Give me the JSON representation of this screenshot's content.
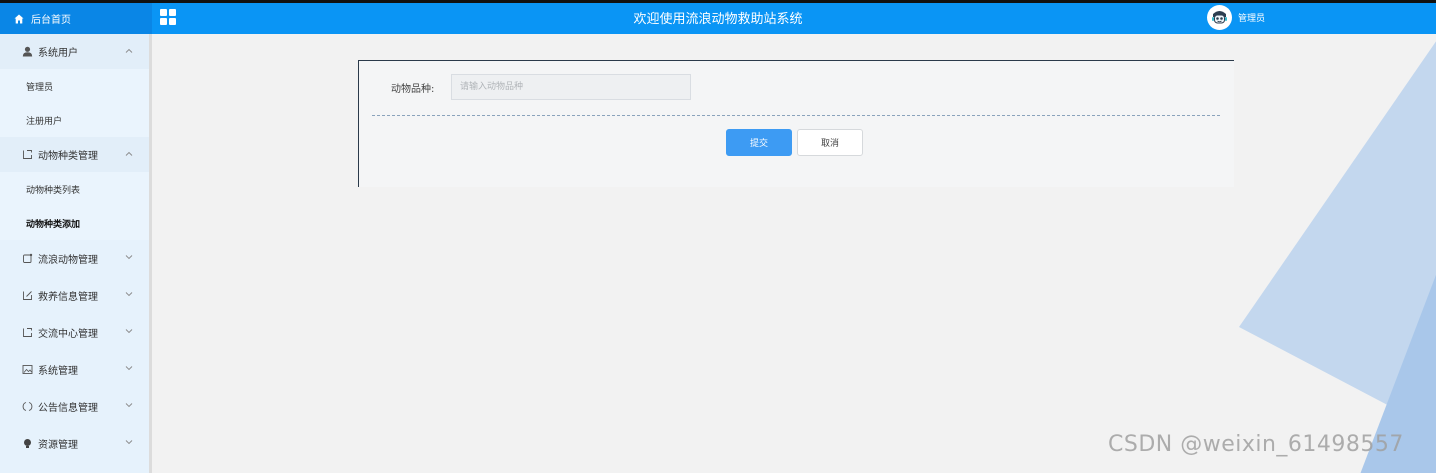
{
  "header": {
    "home_label": "后台首页",
    "title": "欢迎使用流浪动物救助站系统",
    "user_name": "管理员"
  },
  "sidebar": {
    "groups": [
      {
        "label": "系统用户",
        "icon": "user-icon",
        "expanded": true,
        "items": [
          "管理员",
          "注册用户"
        ]
      },
      {
        "label": "动物种类管理",
        "icon": "tag-icon",
        "expanded": true,
        "items": [
          "动物种类列表",
          "动物种类添加"
        ]
      },
      {
        "label": "流浪动物管理",
        "icon": "edit-icon",
        "expanded": false
      },
      {
        "label": "救养信息管理",
        "icon": "edit-icon",
        "expanded": false
      },
      {
        "label": "交流中心管理",
        "icon": "tag-icon",
        "expanded": false
      },
      {
        "label": "系统管理",
        "icon": "picture-icon",
        "expanded": false
      },
      {
        "label": "公告信息管理",
        "icon": "circle-icon",
        "expanded": false
      },
      {
        "label": "资源管理",
        "icon": "bulb-icon",
        "expanded": false
      }
    ],
    "active_item": "动物种类添加"
  },
  "form": {
    "field_label": "动物品种:",
    "field_value": "",
    "field_placeholder": "请输入动物品种",
    "submit_label": "提交",
    "cancel_label": "取消"
  },
  "watermark": "CSDN @weixin_61498557",
  "colors": {
    "header_bg": "#0a95f5",
    "sidebar_bg": "#e6f2fc",
    "primary_button": "#3d9bf3",
    "decor_blue": "#b7cfe9"
  }
}
